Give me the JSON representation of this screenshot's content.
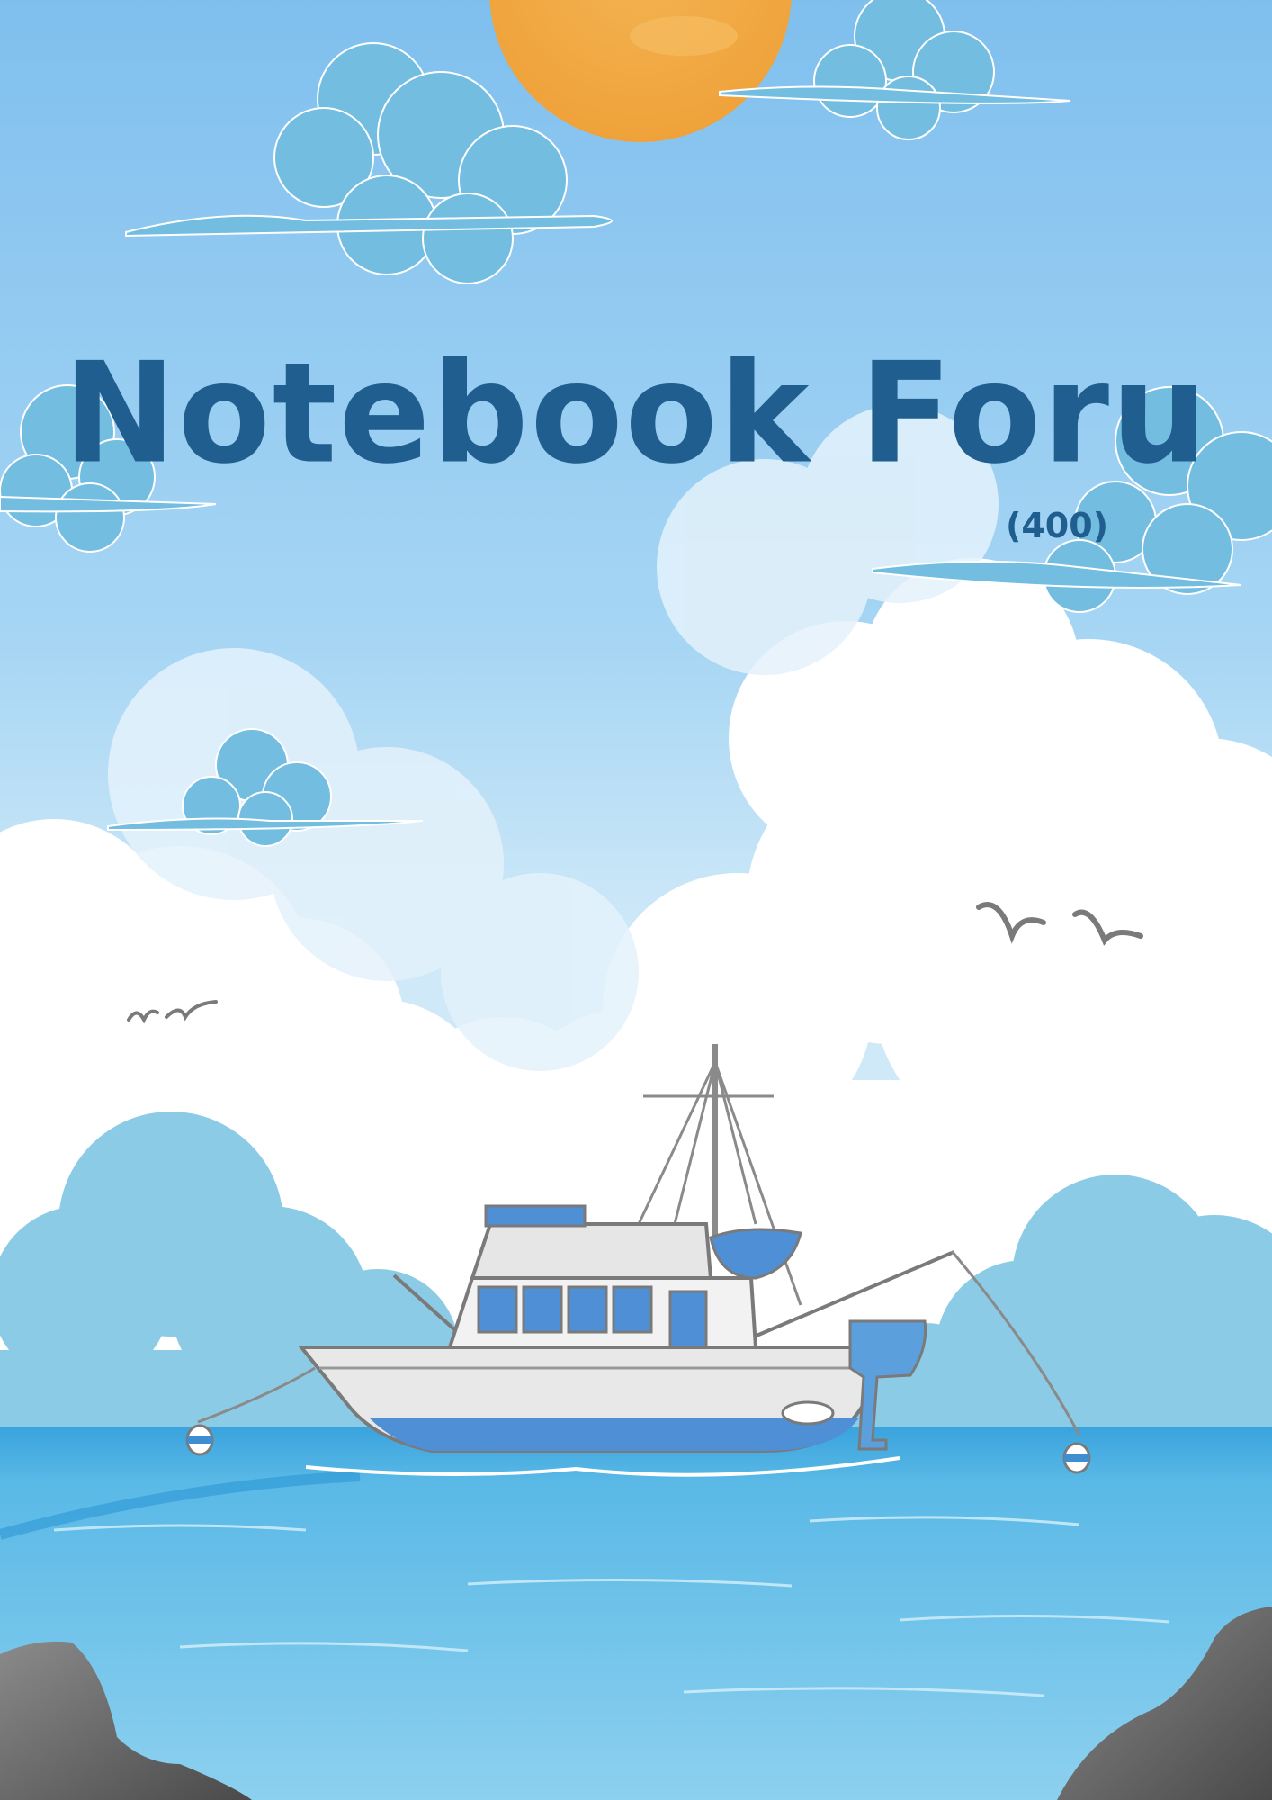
{
  "cover": {
    "title": "Notebook Foru",
    "page_count": "(400)"
  },
  "illustration": {
    "scene": [
      "sun",
      "sky",
      "clouds",
      "birds",
      "fishing-boat",
      "buoys",
      "sea",
      "rocks"
    ]
  },
  "colors": {
    "title": "#1f5e8e",
    "sky": "#8ec9ef",
    "sun": "#f4a93c",
    "sea": "#4fb3e3",
    "cloud_blue": "#7cc0e0",
    "rock": "#5f5f5f"
  }
}
